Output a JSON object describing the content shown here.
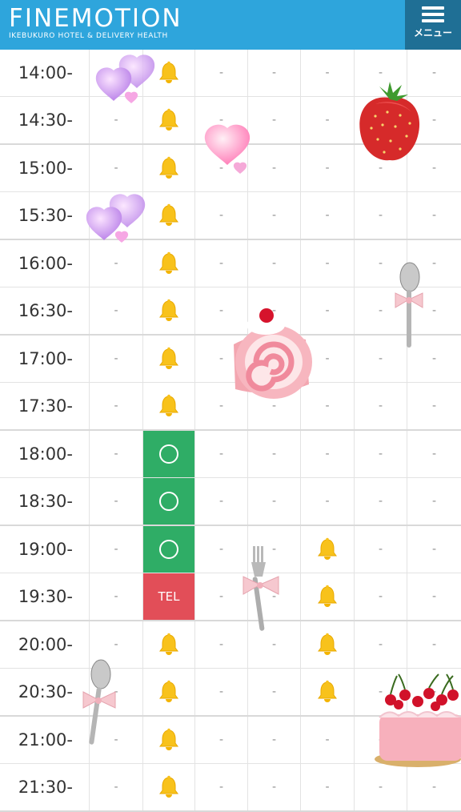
{
  "header": {
    "logo_title": "FINEMOTION",
    "logo_subtitle": "IKEBUKURO HOTEL & DELIVERY HEALTH",
    "menu_label": "メニュー"
  },
  "colors": {
    "header_bg": "#2ea5dc",
    "menu_bg": "#1f6f95",
    "available": "#2fad66",
    "tel": "#e24e58",
    "bell": "#f8c21b"
  },
  "schedule": [
    {
      "time": "14:00-",
      "cells": [
        "-",
        "bell",
        "-",
        "-",
        "-",
        "-",
        "-"
      ]
    },
    {
      "time": "14:30-",
      "cells": [
        "-",
        "bell",
        "-",
        "-",
        "-",
        "-",
        "-"
      ]
    },
    {
      "time": "15:00-",
      "cells": [
        "-",
        "bell",
        "-",
        "-",
        "-",
        "-",
        "-"
      ]
    },
    {
      "time": "15:30-",
      "cells": [
        "-",
        "bell",
        "-",
        "-",
        "-",
        "-",
        "-"
      ]
    },
    {
      "time": "16:00-",
      "cells": [
        "-",
        "bell",
        "-",
        "-",
        "-",
        "-",
        "-"
      ]
    },
    {
      "time": "16:30-",
      "cells": [
        "-",
        "bell",
        "-",
        "-",
        "-",
        "-",
        "-"
      ]
    },
    {
      "time": "17:00-",
      "cells": [
        "-",
        "bell",
        "-",
        "-",
        "-",
        "-",
        "-"
      ]
    },
    {
      "time": "17:30-",
      "cells": [
        "-",
        "bell",
        "-",
        "-",
        "-",
        "-",
        "-"
      ]
    },
    {
      "time": "18:00-",
      "cells": [
        "-",
        "ok",
        "-",
        "-",
        "-",
        "-",
        "-"
      ]
    },
    {
      "time": "18:30-",
      "cells": [
        "-",
        "ok",
        "-",
        "-",
        "-",
        "-",
        "-"
      ]
    },
    {
      "time": "19:00-",
      "cells": [
        "-",
        "ok",
        "-",
        "-",
        "bell",
        "-",
        "-"
      ]
    },
    {
      "time": "19:30-",
      "cells": [
        "-",
        "TEL",
        "-",
        "-",
        "bell",
        "-",
        "-"
      ]
    },
    {
      "time": "20:00-",
      "cells": [
        "-",
        "bell",
        "-",
        "-",
        "bell",
        "-",
        "-"
      ]
    },
    {
      "time": "20:30-",
      "cells": [
        "-",
        "bell",
        "-",
        "-",
        "bell",
        "-",
        "-"
      ]
    },
    {
      "time": "21:00-",
      "cells": [
        "-",
        "bell",
        "-",
        "-",
        "-",
        "-",
        "-"
      ]
    },
    {
      "time": "21:30-",
      "cells": [
        "-",
        "bell",
        "-",
        "-",
        "-",
        "-",
        "-"
      ]
    }
  ],
  "decorations": [
    "hearts-icon",
    "strawberry-icon",
    "hearts-icon",
    "hearts-icon",
    "spoon-icon",
    "roll-cake-icon",
    "fork-icon",
    "spoon-icon",
    "cake-icon"
  ]
}
